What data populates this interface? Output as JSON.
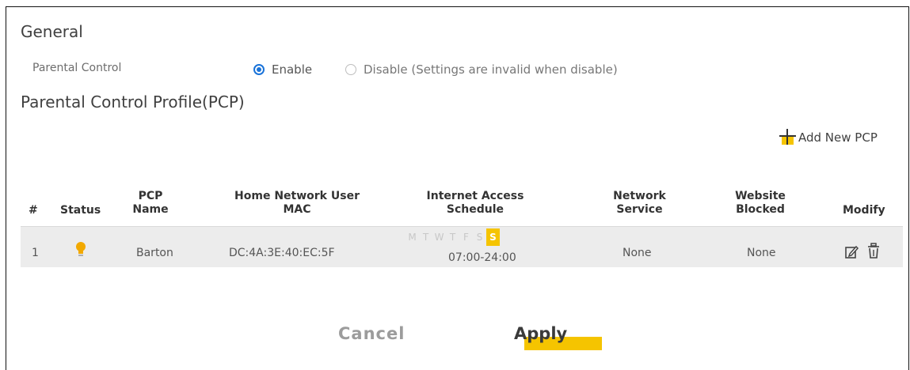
{
  "general": {
    "title": "General",
    "parental_control_label": "Parental Control",
    "enable_label": "Enable",
    "disable_label": "Disable (Settings are invalid when disable)",
    "enabled": true
  },
  "pcp": {
    "title": "Parental Control Profile(PCP)",
    "add_label": "Add New PCP"
  },
  "table": {
    "headers": {
      "num": "#",
      "status": "Status",
      "pcp_name_1": "PCP",
      "pcp_name_2": "Name",
      "mac_1": "Home Network User",
      "mac_2": "MAC",
      "schedule_1": "Internet Access",
      "schedule_2": "Schedule",
      "service_1": "Network",
      "service_2": "Service",
      "blocked_1": "Website",
      "blocked_2": "Blocked",
      "modify": "Modify"
    },
    "rows": [
      {
        "num": "1",
        "status_icon": "bulb-icon",
        "name": "Barton",
        "mac": "DC:4A:3E:40:EC:5F",
        "days": [
          "M",
          "T",
          "W",
          "T",
          "F",
          "S",
          "S"
        ],
        "active_days": [
          6
        ],
        "time": "07:00-24:00",
        "service": "None",
        "blocked": "None"
      }
    ]
  },
  "buttons": {
    "cancel": "Cancel",
    "apply": "Apply"
  },
  "colors": {
    "accent": "#f5c400",
    "radio": "#1a73d9",
    "row_bg": "#ececec"
  }
}
